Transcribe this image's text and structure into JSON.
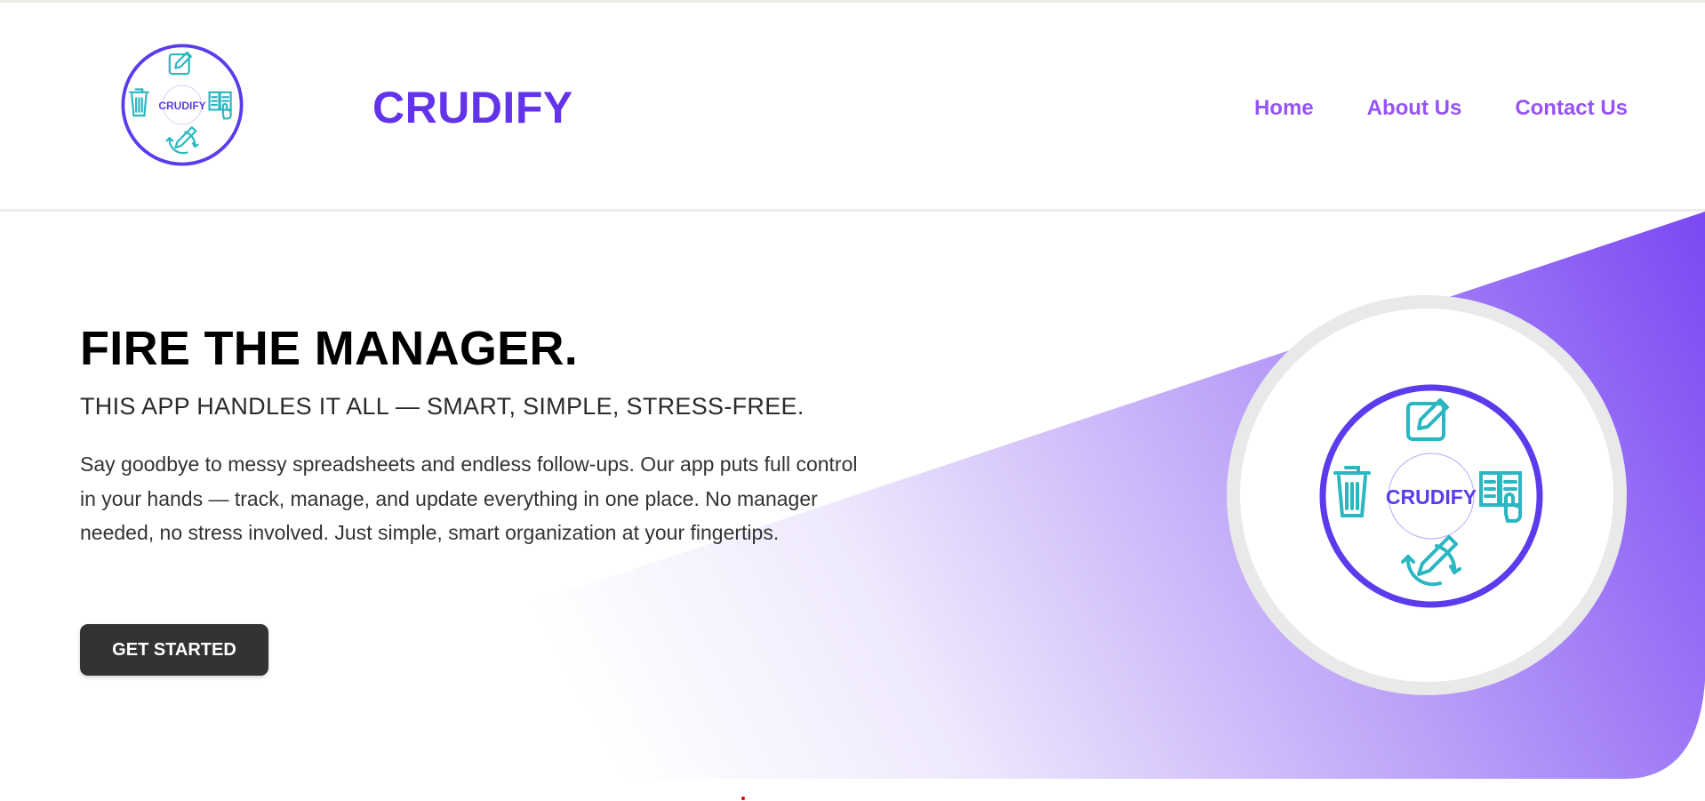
{
  "brand": {
    "name": "CRUDIFY",
    "logo_text": "CRUDIFY"
  },
  "nav": {
    "items": [
      "Home",
      "About Us",
      "Contact Us"
    ]
  },
  "hero": {
    "title": "FIRE THE MANAGER.",
    "subtitle": "THIS APP HANDLES IT ALL — SMART, SIMPLE, STRESS-FREE.",
    "description": "Say goodbye to messy spreadsheets and endless follow-ups. Our app puts full control in your hands — track, manage, and update everything in one place. No manager needed, no stress involved. Just simple, smart organization at your fingertips.",
    "cta_label": "GET STARTED"
  },
  "colors": {
    "brand_purple": "#6233ea",
    "nav_purple": "#9654f5",
    "logo_ring": "#5b3bec",
    "icon_teal": "#2bb7c0",
    "gradient_end": "#7a48f3",
    "cta_bg": "#333333"
  },
  "icons": [
    "edit-icon",
    "trash-icon",
    "read-document-icon",
    "update-pencil-icon"
  ]
}
